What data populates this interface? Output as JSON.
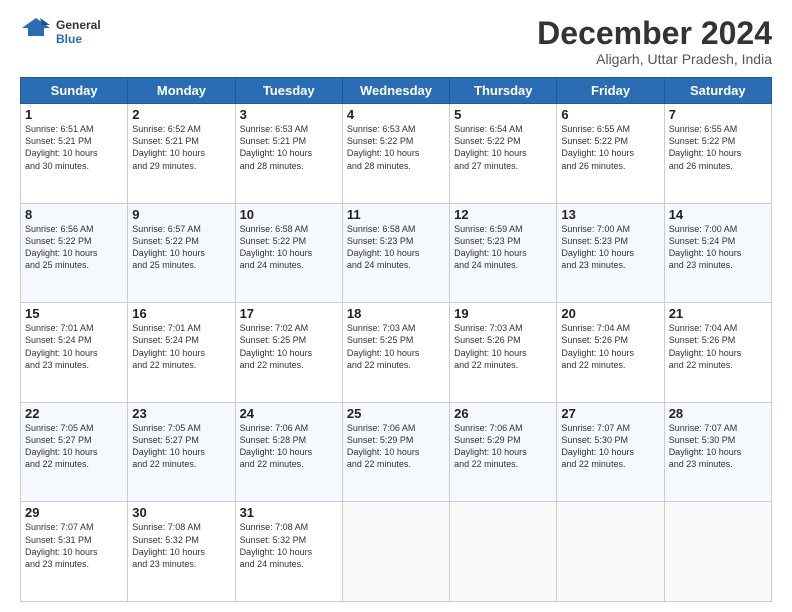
{
  "logo": {
    "line1": "General",
    "line2": "Blue"
  },
  "header": {
    "month": "December 2024",
    "location": "Aligarh, Uttar Pradesh, India"
  },
  "days_of_week": [
    "Sunday",
    "Monday",
    "Tuesday",
    "Wednesday",
    "Thursday",
    "Friday",
    "Saturday"
  ],
  "weeks": [
    [
      {
        "day": "1",
        "text": "Sunrise: 6:51 AM\nSunset: 5:21 PM\nDaylight: 10 hours\nand 30 minutes."
      },
      {
        "day": "2",
        "text": "Sunrise: 6:52 AM\nSunset: 5:21 PM\nDaylight: 10 hours\nand 29 minutes."
      },
      {
        "day": "3",
        "text": "Sunrise: 6:53 AM\nSunset: 5:21 PM\nDaylight: 10 hours\nand 28 minutes."
      },
      {
        "day": "4",
        "text": "Sunrise: 6:53 AM\nSunset: 5:22 PM\nDaylight: 10 hours\nand 28 minutes."
      },
      {
        "day": "5",
        "text": "Sunrise: 6:54 AM\nSunset: 5:22 PM\nDaylight: 10 hours\nand 27 minutes."
      },
      {
        "day": "6",
        "text": "Sunrise: 6:55 AM\nSunset: 5:22 PM\nDaylight: 10 hours\nand 26 minutes."
      },
      {
        "day": "7",
        "text": "Sunrise: 6:55 AM\nSunset: 5:22 PM\nDaylight: 10 hours\nand 26 minutes."
      }
    ],
    [
      {
        "day": "8",
        "text": "Sunrise: 6:56 AM\nSunset: 5:22 PM\nDaylight: 10 hours\nand 25 minutes."
      },
      {
        "day": "9",
        "text": "Sunrise: 6:57 AM\nSunset: 5:22 PM\nDaylight: 10 hours\nand 25 minutes."
      },
      {
        "day": "10",
        "text": "Sunrise: 6:58 AM\nSunset: 5:22 PM\nDaylight: 10 hours\nand 24 minutes."
      },
      {
        "day": "11",
        "text": "Sunrise: 6:58 AM\nSunset: 5:23 PM\nDaylight: 10 hours\nand 24 minutes."
      },
      {
        "day": "12",
        "text": "Sunrise: 6:59 AM\nSunset: 5:23 PM\nDaylight: 10 hours\nand 24 minutes."
      },
      {
        "day": "13",
        "text": "Sunrise: 7:00 AM\nSunset: 5:23 PM\nDaylight: 10 hours\nand 23 minutes."
      },
      {
        "day": "14",
        "text": "Sunrise: 7:00 AM\nSunset: 5:24 PM\nDaylight: 10 hours\nand 23 minutes."
      }
    ],
    [
      {
        "day": "15",
        "text": "Sunrise: 7:01 AM\nSunset: 5:24 PM\nDaylight: 10 hours\nand 23 minutes."
      },
      {
        "day": "16",
        "text": "Sunrise: 7:01 AM\nSunset: 5:24 PM\nDaylight: 10 hours\nand 22 minutes."
      },
      {
        "day": "17",
        "text": "Sunrise: 7:02 AM\nSunset: 5:25 PM\nDaylight: 10 hours\nand 22 minutes."
      },
      {
        "day": "18",
        "text": "Sunrise: 7:03 AM\nSunset: 5:25 PM\nDaylight: 10 hours\nand 22 minutes."
      },
      {
        "day": "19",
        "text": "Sunrise: 7:03 AM\nSunset: 5:26 PM\nDaylight: 10 hours\nand 22 minutes."
      },
      {
        "day": "20",
        "text": "Sunrise: 7:04 AM\nSunset: 5:26 PM\nDaylight: 10 hours\nand 22 minutes."
      },
      {
        "day": "21",
        "text": "Sunrise: 7:04 AM\nSunset: 5:26 PM\nDaylight: 10 hours\nand 22 minutes."
      }
    ],
    [
      {
        "day": "22",
        "text": "Sunrise: 7:05 AM\nSunset: 5:27 PM\nDaylight: 10 hours\nand 22 minutes."
      },
      {
        "day": "23",
        "text": "Sunrise: 7:05 AM\nSunset: 5:27 PM\nDaylight: 10 hours\nand 22 minutes."
      },
      {
        "day": "24",
        "text": "Sunrise: 7:06 AM\nSunset: 5:28 PM\nDaylight: 10 hours\nand 22 minutes."
      },
      {
        "day": "25",
        "text": "Sunrise: 7:06 AM\nSunset: 5:29 PM\nDaylight: 10 hours\nand 22 minutes."
      },
      {
        "day": "26",
        "text": "Sunrise: 7:06 AM\nSunset: 5:29 PM\nDaylight: 10 hours\nand 22 minutes."
      },
      {
        "day": "27",
        "text": "Sunrise: 7:07 AM\nSunset: 5:30 PM\nDaylight: 10 hours\nand 22 minutes."
      },
      {
        "day": "28",
        "text": "Sunrise: 7:07 AM\nSunset: 5:30 PM\nDaylight: 10 hours\nand 23 minutes."
      }
    ],
    [
      {
        "day": "29",
        "text": "Sunrise: 7:07 AM\nSunset: 5:31 PM\nDaylight: 10 hours\nand 23 minutes."
      },
      {
        "day": "30",
        "text": "Sunrise: 7:08 AM\nSunset: 5:32 PM\nDaylight: 10 hours\nand 23 minutes."
      },
      {
        "day": "31",
        "text": "Sunrise: 7:08 AM\nSunset: 5:32 PM\nDaylight: 10 hours\nand 24 minutes."
      },
      {
        "day": "",
        "text": ""
      },
      {
        "day": "",
        "text": ""
      },
      {
        "day": "",
        "text": ""
      },
      {
        "day": "",
        "text": ""
      }
    ]
  ]
}
